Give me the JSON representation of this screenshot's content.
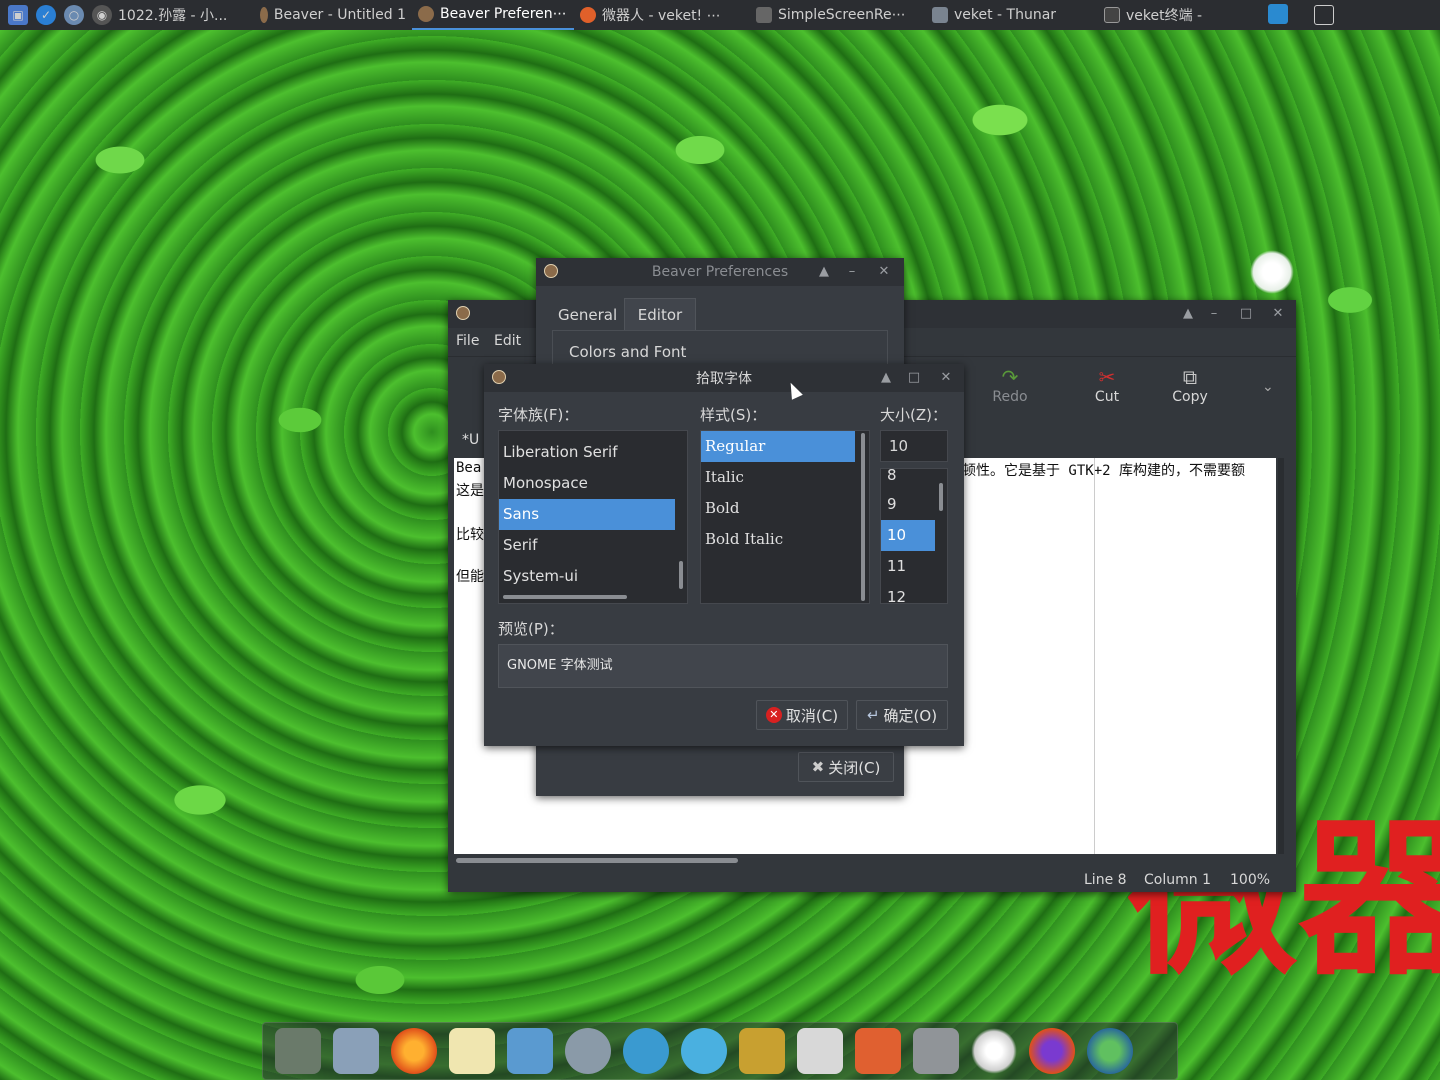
{
  "taskbar": {
    "tasks": [
      {
        "label": "1022.孙露 - 小..."
      },
      {
        "label": "Beaver - Untitled 1"
      },
      {
        "label": "Beaver Preferen⋯"
      },
      {
        "label": "微器人 - veket! ⋯"
      },
      {
        "label": "SimpleScreenRe⋯"
      },
      {
        "label": "veket - Thunar"
      },
      {
        "label": "veket终端 -"
      }
    ]
  },
  "prefs": {
    "title": "Beaver Preferences",
    "tabs": [
      "General",
      "Editor"
    ],
    "section": "Colors and Font",
    "close_label": "关闭(C)"
  },
  "editor": {
    "menu": [
      "File",
      "Edit"
    ],
    "toolbar": {
      "redo": "Redo",
      "cut": "Cut",
      "copy": "Copy"
    },
    "tab_label": "*U",
    "lines": [
      "Bea",
      "这是",
      "",
      "比较",
      "",
      "但能"
    ],
    "right_text": "顿性。它是基于 GTK+2 库构建的，不需要额",
    "status": {
      "line": "Line 8",
      "column": "Column 1",
      "zoom": "100%"
    }
  },
  "font_dialog": {
    "title": "拾取字体",
    "family_label": "字体族(F)：",
    "style_label": "样式(S)：",
    "size_label": "大小(Z)：",
    "families": [
      "Liberation Serif",
      "Monospace",
      "Sans",
      "Serif",
      "System-ui"
    ],
    "selected_family": "Sans",
    "styles": [
      "Regular",
      "Italic",
      "Bold",
      "Bold Italic"
    ],
    "selected_style": "Regular",
    "size_value": "10",
    "sizes": [
      "8",
      "9",
      "10",
      "11",
      "12"
    ],
    "selected_size": "10",
    "preview_label": "预览(P)：",
    "preview_text": "GNOME 字体测试",
    "cancel_label": "取消(C)",
    "ok_label": "确定(O)"
  },
  "desktop": {
    "banner_text": "微器"
  },
  "colors": {
    "accent": "#4a90d9",
    "window_bg": "#383c42",
    "titlebar": "#2e3136",
    "banner_red": "#e02020"
  }
}
